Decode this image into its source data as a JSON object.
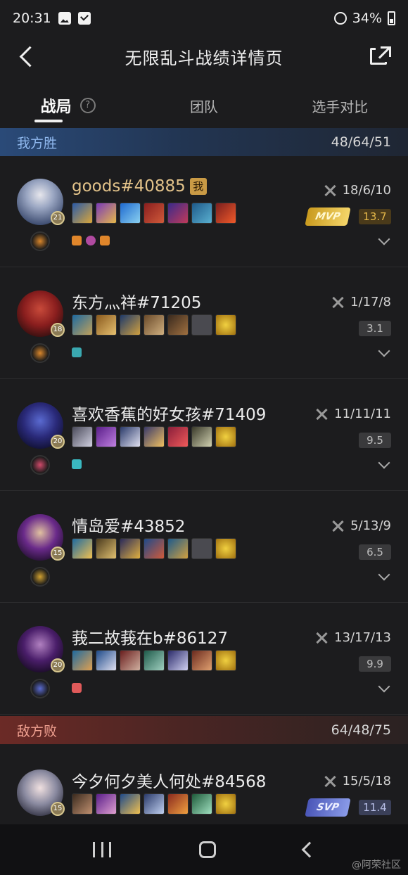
{
  "status_bar": {
    "time": "20:31",
    "battery": "34%"
  },
  "nav": {
    "title": "无限乱斗战绩详情页"
  },
  "tabs": [
    {
      "label": "战局"
    },
    {
      "label": "团队"
    },
    {
      "label": "选手对比"
    }
  ],
  "teams": {
    "ally": {
      "result": "我方胜",
      "score": "48/64/51"
    },
    "enemy": {
      "result": "敌方败",
      "score": "64/48/75"
    }
  },
  "players": [
    {
      "name": "goods#40885",
      "me_badge": "我",
      "level": "21",
      "kda": "18/6/10",
      "rating": "13.7",
      "badge": "MVP"
    },
    {
      "name": "东方灬祥#71205",
      "level": "18",
      "kda": "1/17/8",
      "rating": "3.1"
    },
    {
      "name": "喜欢香蕉的好女孩#71409",
      "level": "20",
      "kda": "11/11/11",
      "rating": "9.5"
    },
    {
      "name": "情岛爱#43852",
      "level": "15",
      "kda": "5/13/9",
      "rating": "6.5"
    },
    {
      "name": "莪二故莪在b#86127",
      "level": "20",
      "kda": "13/17/13",
      "rating": "9.9"
    },
    {
      "name": "今夕何夕美人何处#84568",
      "level": "15",
      "kda": "15/5/18",
      "rating": "11.4",
      "badge": "SVP"
    }
  ],
  "watermark": "@阿荣社区",
  "colors": {
    "background": "#1c1c1e",
    "ally_accent": "#2a4a78",
    "enemy_accent": "#6b2a26",
    "mvp_gold": "#e6b94a"
  },
  "icons": [
    "back-icon",
    "share-icon",
    "help-icon",
    "kda-icon",
    "chevron-down-icon"
  ]
}
